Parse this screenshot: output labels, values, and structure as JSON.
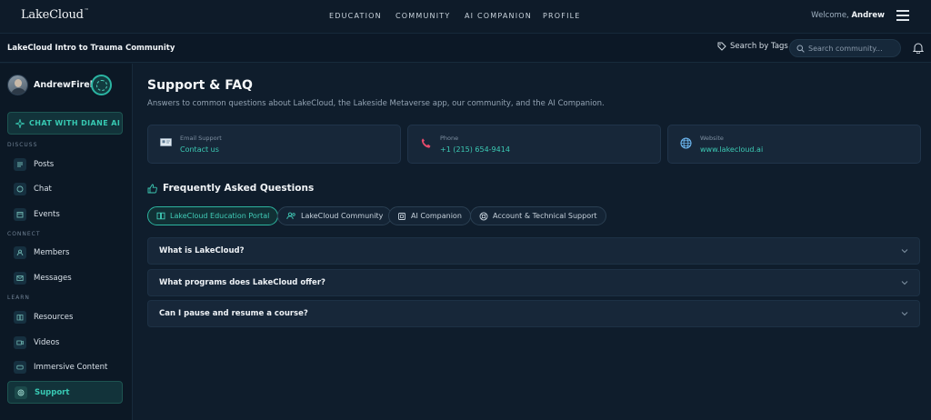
{
  "header": {
    "logo": "LakeCloud",
    "logo_mark": "™",
    "nav": [
      "EDUCATION",
      "COMMUNITY",
      "AI COMPANION",
      "PROFILE"
    ],
    "welcome_prefix": "Welcome,",
    "welcome_name": "Andrew"
  },
  "subheader": {
    "community_title": "LakeCloud Intro to Trauma Community",
    "search_by_tags": "Search by Tags",
    "search_placeholder": "Search community..."
  },
  "sidebar": {
    "profile_name": "AndrewFirek",
    "chat_button": "CHAT WITH DIANE AI",
    "sections": {
      "discuss": "DISCUSS",
      "connect": "CONNECT",
      "learn": "LEARN"
    },
    "items": [
      {
        "label": "Posts",
        "icon": "posts-icon"
      },
      {
        "label": "Chat",
        "icon": "chat-icon"
      },
      {
        "label": "Events",
        "icon": "calendar-icon"
      },
      {
        "label": "Members",
        "icon": "members-icon"
      },
      {
        "label": "Messages",
        "icon": "mail-icon"
      },
      {
        "label": "Resources",
        "icon": "book-icon"
      },
      {
        "label": "Videos",
        "icon": "video-icon"
      },
      {
        "label": "Immersive Content",
        "icon": "vr-icon"
      },
      {
        "label": "Support",
        "icon": "support-icon",
        "active": true
      }
    ]
  },
  "main": {
    "title": "Support & FAQ",
    "subtitle": "Answers to common questions about LakeCloud, the Lakeside Metaverse app, our community, and the AI Companion.",
    "contacts": [
      {
        "label": "Email Support",
        "value": "Contact us",
        "icon": "email-icon"
      },
      {
        "label": "Phone",
        "value": "+1 (215) 654-9414",
        "icon": "phone-icon"
      },
      {
        "label": "Website",
        "value": "www.lakecloud.ai",
        "icon": "globe-icon"
      }
    ],
    "faq_heading": "Frequently Asked Questions",
    "tabs": [
      {
        "label": "LakeCloud Education Portal",
        "active": true
      },
      {
        "label": "LakeCloud Community"
      },
      {
        "label": "AI Companion"
      },
      {
        "label": "Account & Technical Support"
      }
    ],
    "questions": [
      "What is LakeCloud?",
      "What programs does LakeCloud offer?",
      "Can I pause and resume a course?"
    ]
  },
  "colors": {
    "background": "#0f1d2c",
    "accent": "#3ccab4",
    "card": "#172739"
  }
}
